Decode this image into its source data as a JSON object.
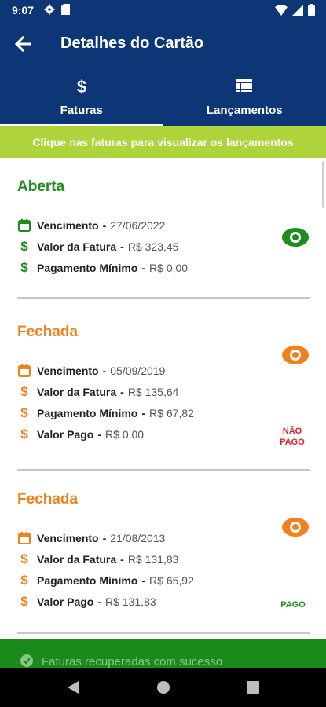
{
  "status_bar": {
    "time": "9:07"
  },
  "app_bar": {
    "title": "Detalhes do Cartão"
  },
  "tabs": [
    {
      "label": "Faturas",
      "icon": "dollar-icon",
      "selected": true
    },
    {
      "label": "Lançamentos",
      "icon": "list-icon",
      "selected": false
    }
  ],
  "banner": {
    "text": "Clique nas faturas para visualizar os lançamentos"
  },
  "colors": {
    "primary": "#0d3677",
    "banner": "#afd33b",
    "open": "#1e8c1e",
    "closed": "#f0821e",
    "unpaid": "#e0202a",
    "paid": "#1e8c1e",
    "toast": "#1a8b1a"
  },
  "invoices": [
    {
      "status": "Aberta",
      "due_label": "Vencimento",
      "due": "27/06/2022",
      "amount_label": "Valor da Fatura",
      "amount": "R$ 323,45",
      "minimum_label": "Pagamento Mínimo",
      "minimum": "R$ 0,00"
    },
    {
      "status": "Fechada",
      "due_label": "Vencimento",
      "due": "05/09/2019",
      "amount_label": "Valor da Fatura",
      "amount": "R$ 135,64",
      "minimum_label": "Pagamento Mínimo",
      "minimum": "R$ 67,82",
      "paid_label": "Valor Pago",
      "paid": "R$ 0,00",
      "payment_status_line1": "NÃO",
      "payment_status_line2": "PAGO"
    },
    {
      "status": "Fechada",
      "due_label": "Vencimento",
      "due": "21/08/2013",
      "amount_label": "Valor da Fatura",
      "amount": "R$ 131,83",
      "minimum_label": "Pagamento Mínimo",
      "minimum": "R$ 65,92",
      "paid_label": "Valor Pago",
      "paid": "R$ 131,83",
      "payment_status": "PAGO"
    }
  ],
  "toast": {
    "text": "Faturas recuperadas com sucesso"
  }
}
